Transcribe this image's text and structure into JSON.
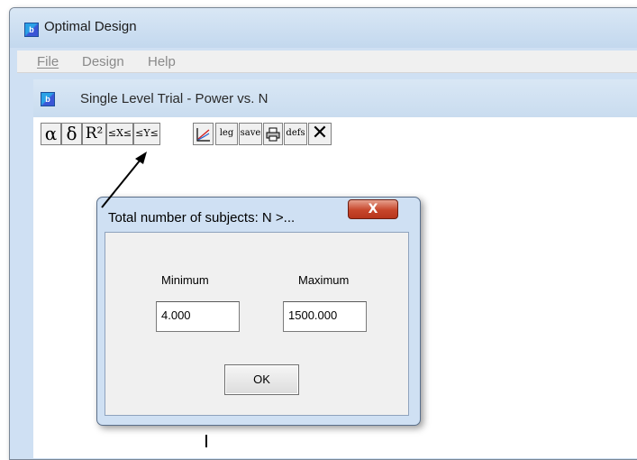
{
  "app": {
    "title": "Optimal Design",
    "icon_glyph": "b"
  },
  "menu": {
    "items": [
      "File",
      "Design",
      "Help"
    ]
  },
  "child_window": {
    "title": "Single Level Trial - Power vs. N"
  },
  "toolbar": {
    "buttons": {
      "alpha": "α",
      "delta": "δ",
      "r2": "R²",
      "sxs": "≤X≤",
      "sys": "≤Y≤",
      "chart": "chart-icon",
      "leg": "leg",
      "save": "save",
      "print": "printer-icon",
      "defs": "defs",
      "close": "✕"
    }
  },
  "dialog": {
    "title": "Total number of subjects: N >...",
    "close_glyph": "X",
    "minimum": {
      "label": "Minimum",
      "value": "4.000"
    },
    "maximum": {
      "label": "Maximum",
      "value": "1500.000"
    },
    "ok_label": "OK"
  },
  "colors": {
    "window_frame": "#cfe0f3",
    "close_button": "#c7462b"
  }
}
